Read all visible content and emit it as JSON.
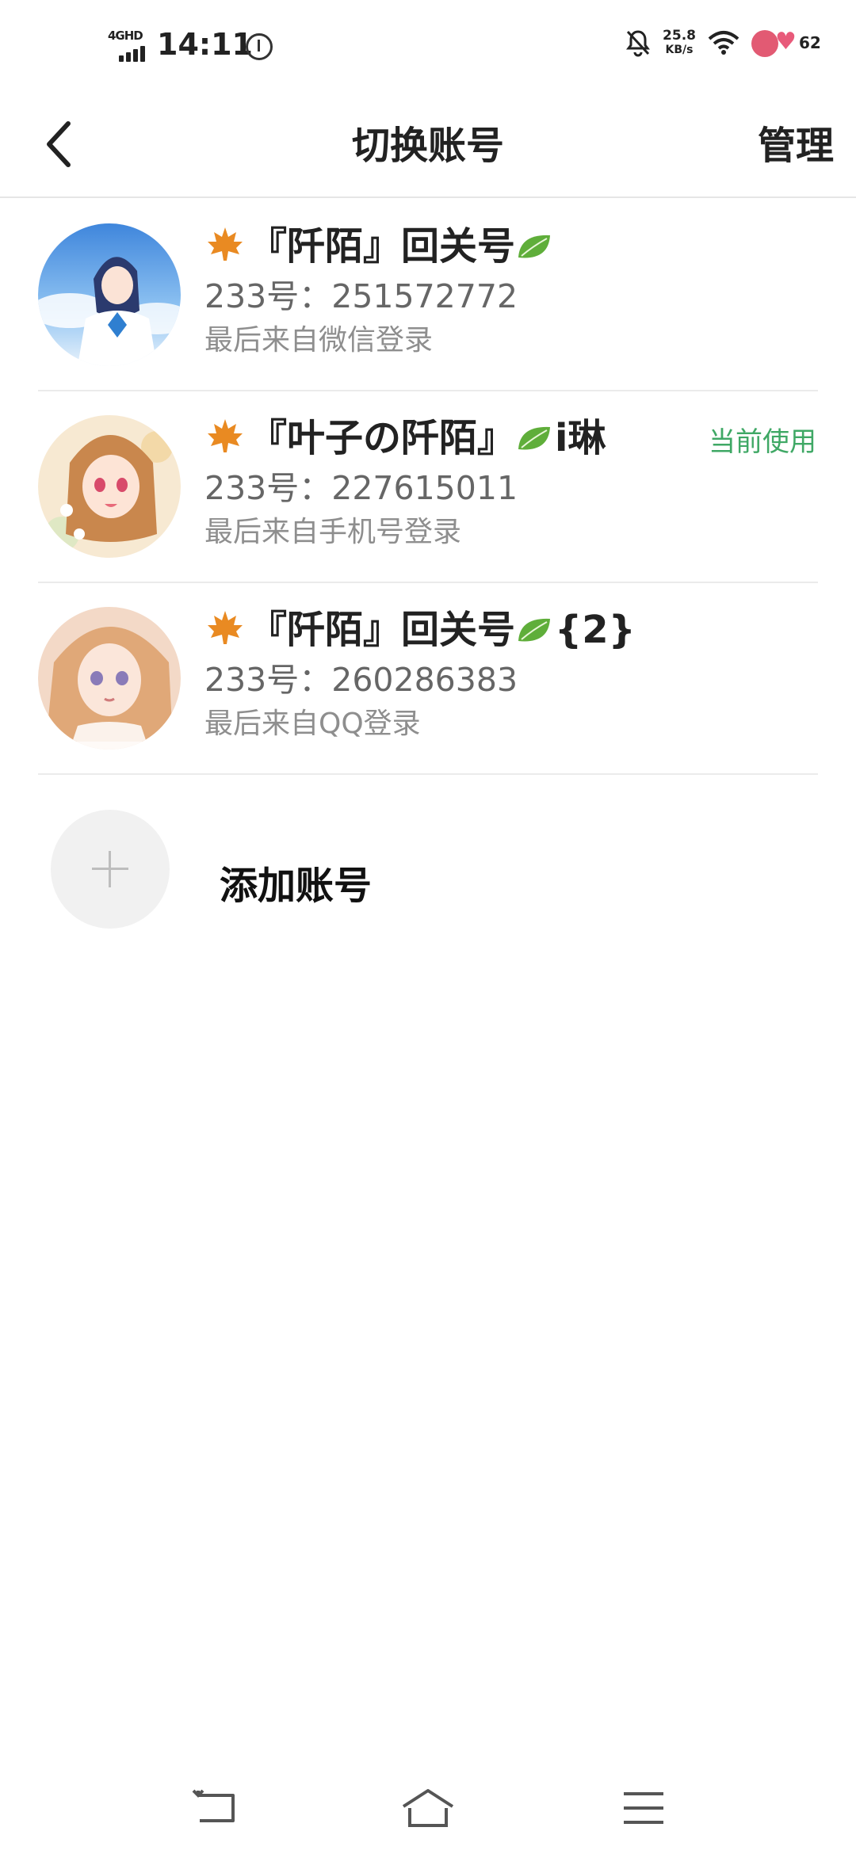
{
  "status_bar": {
    "network": "4GHD",
    "time": "14:11",
    "speed_value": "25.8",
    "speed_unit": "KB/s",
    "battery": "62"
  },
  "header": {
    "title": "切换账号",
    "manage_label": "管理"
  },
  "accounts": [
    {
      "name_prefix": "『阡陌』回关号",
      "name_suffix": "",
      "uid": "233号：251572772",
      "last_login": "最后来自微信登录",
      "current_label": ""
    },
    {
      "name_prefix": "『叶子の阡陌』",
      "name_suffix": "i琳",
      "uid": "233号：227615011",
      "last_login": "最后来自手机号登录",
      "current_label": "当前使用"
    },
    {
      "name_prefix": "『阡陌』回关号",
      "name_suffix": "{2}",
      "uid": "233号：260286383",
      "last_login": "最后来自QQ登录",
      "current_label": ""
    }
  ],
  "add_account": {
    "label": "添加账号"
  },
  "colors": {
    "current_green": "#3fa865",
    "divider": "#ebebeb"
  },
  "icons": {
    "back": "chevron-left-icon",
    "nav_back": "back-arrow-icon",
    "nav_home": "home-icon",
    "nav_menu": "menu-icon"
  }
}
